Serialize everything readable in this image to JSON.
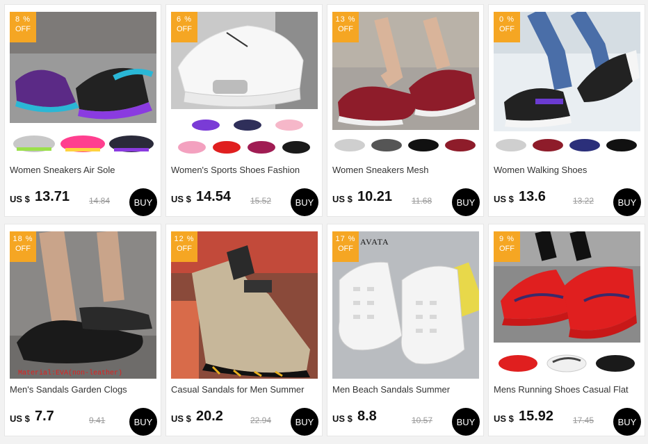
{
  "products": [
    {
      "discount_pct": "8 %",
      "off_label": "OFF",
      "title": "Women Sneakers Air Sole",
      "currency": "US $",
      "price": "13.71",
      "old_price": "14.84",
      "buy_label": "BUY"
    },
    {
      "discount_pct": "6 %",
      "off_label": "OFF",
      "title": "Women's Sports Shoes Fashion",
      "currency": "US $",
      "price": "14.54",
      "old_price": "15.52",
      "buy_label": "BUY"
    },
    {
      "discount_pct": "13 %",
      "off_label": "OFF",
      "title": "Women Sneakers Mesh",
      "currency": "US $",
      "price": "10.21",
      "old_price": "11.68",
      "buy_label": "BUY"
    },
    {
      "discount_pct": "0 %",
      "off_label": "OFF",
      "title": "Women Walking Shoes",
      "currency": "US $",
      "price": "13.6",
      "old_price": "13.22",
      "buy_label": "BUY"
    },
    {
      "discount_pct": "18 %",
      "off_label": "OFF",
      "title": "Men's Sandals Garden Clogs",
      "currency": "US $",
      "price": "7.7",
      "old_price": "9.41",
      "buy_label": "BUY",
      "image_caption": "Material:EVA(non-leather)"
    },
    {
      "discount_pct": "12 %",
      "off_label": "OFF",
      "title": "Casual Sandals for Men Summer",
      "currency": "US $",
      "price": "20.2",
      "old_price": "22.94",
      "buy_label": "BUY"
    },
    {
      "discount_pct": "17 %",
      "off_label": "OFF",
      "title": "Men Beach Sandals Summer",
      "currency": "US $",
      "price": "8.8",
      "old_price": "10.57",
      "buy_label": "BUY",
      "image_caption": "AVATA"
    },
    {
      "discount_pct": "9 %",
      "off_label": "OFF",
      "title": "Mens Running Shoes Casual Flat",
      "currency": "US $",
      "price": "15.92",
      "old_price": "17.45",
      "buy_label": "BUY"
    }
  ],
  "colors": {
    "badge": "#f5a623",
    "buy_button": "#000000",
    "page_bg": "#f2f2f2"
  }
}
